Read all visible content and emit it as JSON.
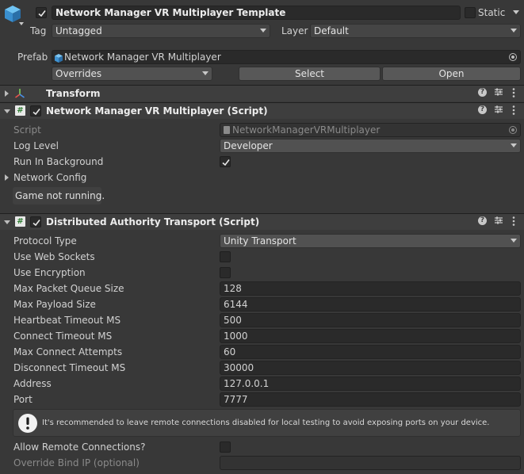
{
  "gameobject": {
    "name": "Network Manager VR Multiplayer Template",
    "static_label": "Static",
    "tag_label": "Tag",
    "tag_value": "Untagged",
    "layer_label": "Layer",
    "layer_value": "Default",
    "prefab_label": "Prefab",
    "prefab_value": "Network Manager VR Multiplayer",
    "overrides_label": "Overrides",
    "select_label": "Select",
    "open_label": "Open"
  },
  "transform": {
    "title": "Transform"
  },
  "network_manager": {
    "title": "Network Manager VR Multiplayer (Script)",
    "script_label": "Script",
    "script_value": "NetworkManagerVRMultiplayer",
    "log_level_label": "Log Level",
    "log_level_value": "Developer",
    "run_in_background_label": "Run In Background",
    "run_in_background": true,
    "network_config_label": "Network Config",
    "status_text": "Game not running."
  },
  "transport": {
    "title": "Distributed Authority Transport (Script)",
    "protocol_type_label": "Protocol Type",
    "protocol_type_value": "Unity Transport",
    "use_web_sockets_label": "Use Web Sockets",
    "use_encryption_label": "Use Encryption",
    "fields": [
      {
        "label": "Max Packet Queue Size",
        "value": "128"
      },
      {
        "label": "Max Payload Size",
        "value": "6144"
      },
      {
        "label": "Heartbeat Timeout MS",
        "value": "500"
      },
      {
        "label": "Connect Timeout MS",
        "value": "1000"
      },
      {
        "label": "Max Connect Attempts",
        "value": "60"
      },
      {
        "label": "Disconnect Timeout MS",
        "value": "30000"
      },
      {
        "label": "Address",
        "value": "127.0.0.1"
      },
      {
        "label": "Port",
        "value": "7777"
      }
    ],
    "warning_text": "It's recommended to leave remote connections disabled for local testing to avoid exposing ports on your device.",
    "allow_remote_label": "Allow Remote Connections?",
    "override_bind_label": "Override Bind IP (optional)"
  },
  "colors": {
    "background": "#383838",
    "field": "#2a2a2a",
    "dropdown": "#515151",
    "prefab_icon": "#4a9bd9"
  }
}
